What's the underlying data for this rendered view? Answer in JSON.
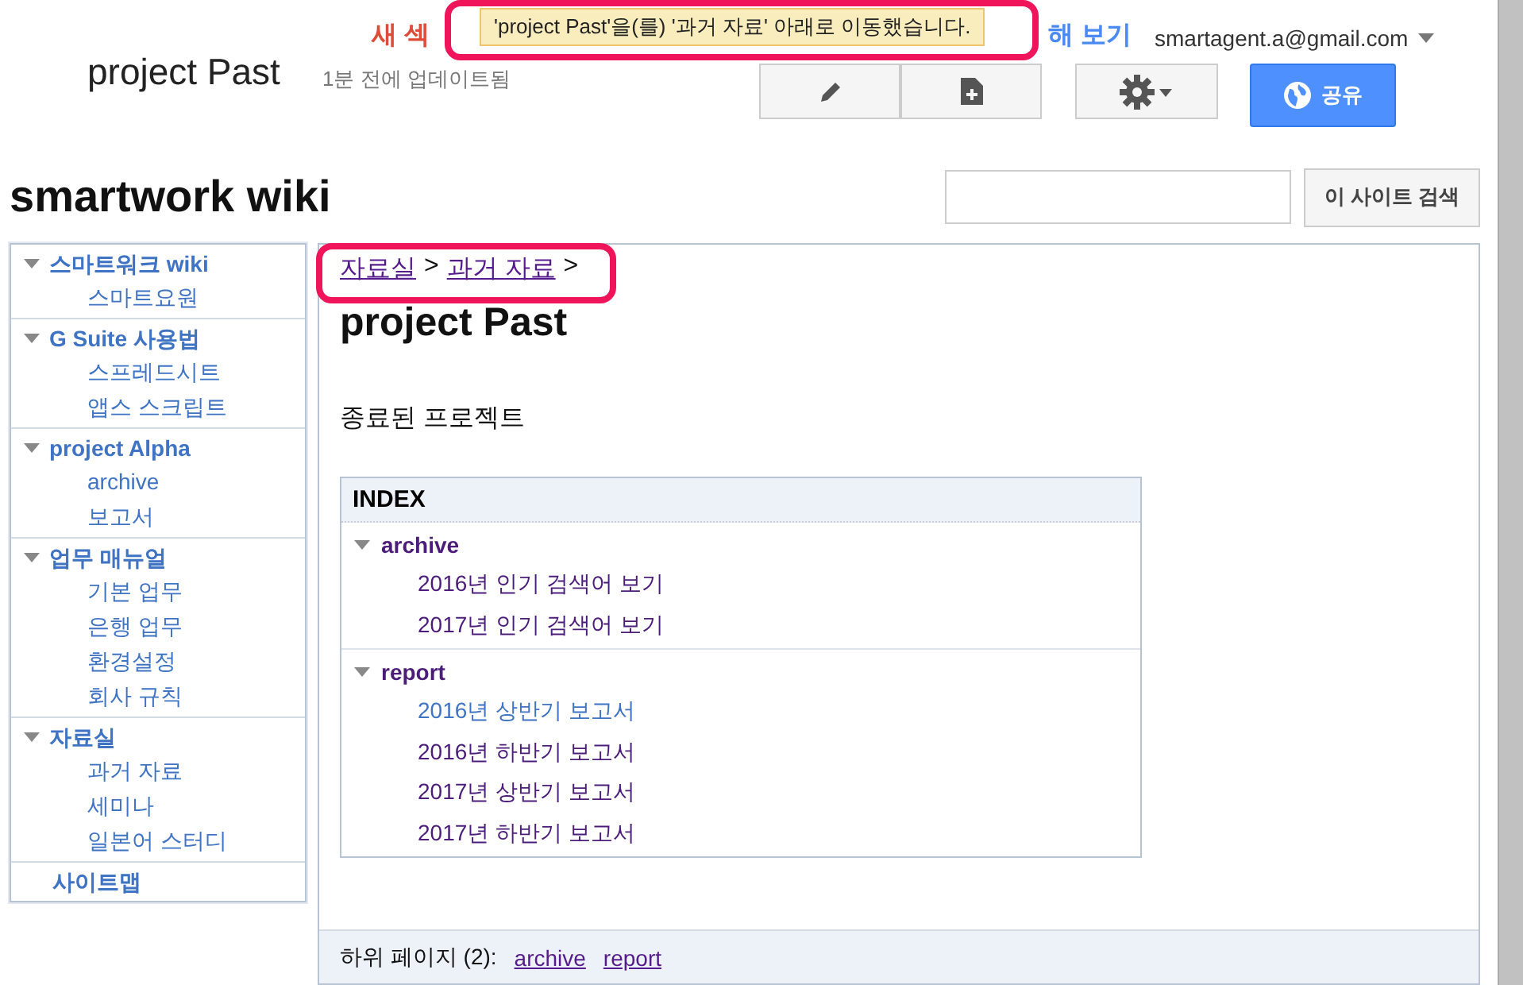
{
  "top_notice": {
    "left_text": "새 섹",
    "right_text": "해 보기"
  },
  "toast": {
    "message": "'project Past'을(를) '과거 자료' 아래로 이동했습니다."
  },
  "account": {
    "email": "smartagent.a@gmail.com"
  },
  "page_header": {
    "title": "project Past",
    "updated": "1분 전에 업데이트됨"
  },
  "share_button": {
    "label": "공유"
  },
  "site": {
    "name": "smartwork wiki"
  },
  "search": {
    "button": "이 사이트 검색"
  },
  "sidebar": {
    "items": [
      {
        "label": "스마트워크 wiki",
        "children": [
          {
            "label": "스마트요원"
          }
        ]
      },
      {
        "label": "G Suite 사용법",
        "children": [
          {
            "label": "스프레드시트"
          },
          {
            "label": "앱스 스크립트"
          }
        ]
      },
      {
        "label": "project Alpha",
        "children": [
          {
            "label": "archive"
          },
          {
            "label": "보고서"
          }
        ]
      },
      {
        "label": "업무 매뉴얼",
        "children": [
          {
            "label": "기본 업무"
          },
          {
            "label": "은행 업무"
          },
          {
            "label": "환경설정"
          },
          {
            "label": "회사 규칙"
          }
        ]
      },
      {
        "label": "자료실",
        "children": [
          {
            "label": "과거 자료"
          },
          {
            "label": "세미나"
          },
          {
            "label": "일본어 스터디"
          }
        ]
      },
      {
        "label": "사이트맵"
      }
    ]
  },
  "breadcrumb": [
    {
      "label": "자료실",
      "separator": ">"
    },
    {
      "label": "과거 자료",
      "separator": ">"
    }
  ],
  "content": {
    "title": "project Past",
    "description": "종료된 프로젝트",
    "index": {
      "heading": "INDEX",
      "groups": [
        {
          "label": "archive",
          "children": [
            {
              "label": "2016년 인기 검색어 보기",
              "visited": true
            },
            {
              "label": "2017년 인기 검색어 보기",
              "visited": true
            }
          ]
        },
        {
          "label": "report",
          "children": [
            {
              "label": "2016년 상반기 보고서",
              "visited": false
            },
            {
              "label": "2016년 하반기 보고서",
              "visited": true
            },
            {
              "label": "2017년 상반기 보고서",
              "visited": true
            },
            {
              "label": "2017년 하반기 보고서",
              "visited": true
            }
          ]
        }
      ]
    }
  },
  "subpages": {
    "label": "하위 페이지 (2):",
    "links": [
      "archive",
      "report"
    ]
  }
}
